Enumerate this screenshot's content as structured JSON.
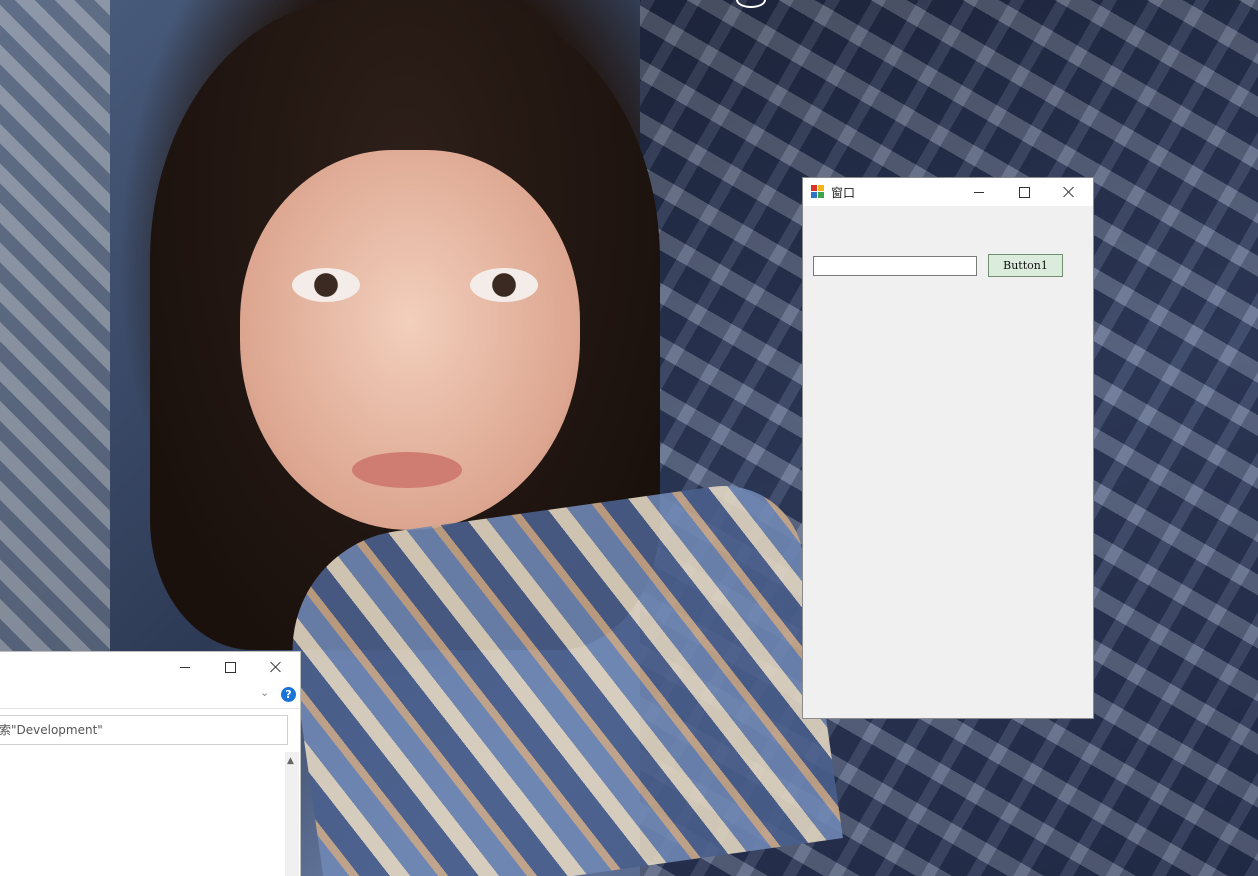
{
  "desktop": {
    "wallpaper": "photo-portrait"
  },
  "main_window": {
    "title": "窗口",
    "app_icon": "winforms-app-icon",
    "textbox_value": "",
    "button_label": "Button1"
  },
  "explorer_window": {
    "search_placeholder": "索\"Development\"",
    "help_label": "?",
    "chevron": "⌄",
    "scroll_up": "▲"
  },
  "colors": {
    "window_bg": "#f0f0f0",
    "titlebar_bg": "#ffffff",
    "button_bg": "#dcecdc",
    "help_blue": "#1a73d8"
  }
}
